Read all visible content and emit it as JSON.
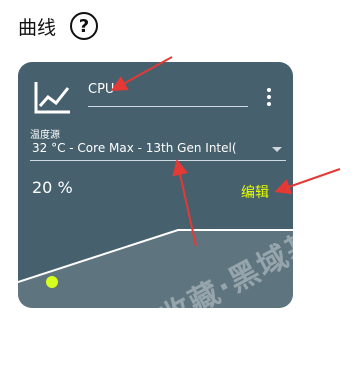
{
  "header": {
    "title": "曲线",
    "help_icon": "question-circle-icon",
    "help_symbol": "?"
  },
  "card": {
    "icon": "line-chart-icon",
    "name_value": "CPU",
    "menu_icon": "more-vertical-icon",
    "source_label": "温度源",
    "source_value": "32 °C - Core Max - 13th Gen Intel(",
    "percent": "20 %",
    "edit_label": "编辑"
  },
  "curve": {
    "point_color": "#d6ff1f",
    "line_color": "#ffffff"
  },
  "watermark": {
    "text": "独家收藏·黑域基地 Hybase.com"
  },
  "colors": {
    "card_bg": "#46606e",
    "accent": "#e6ff00",
    "annotation_red": "#e53935"
  }
}
